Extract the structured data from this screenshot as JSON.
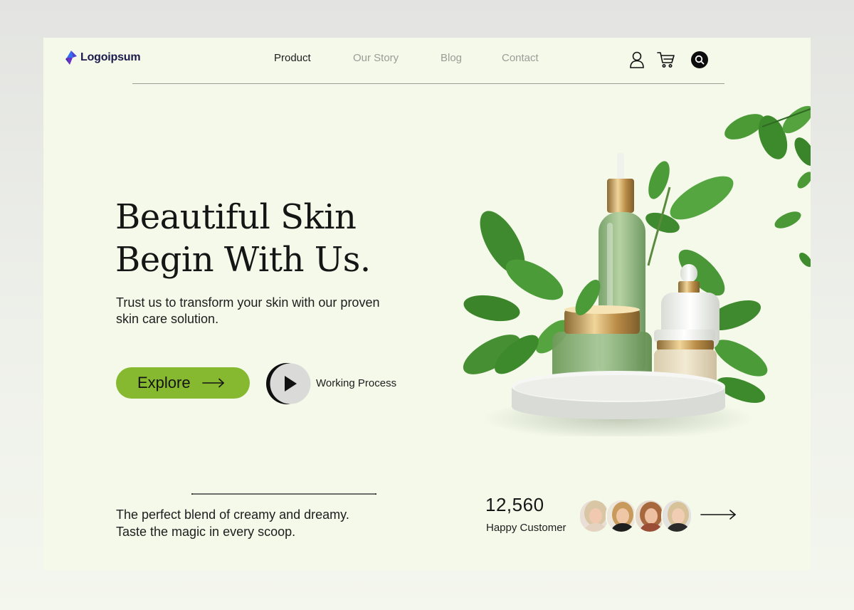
{
  "brand": {
    "name": "Logoipsum"
  },
  "nav": {
    "items": [
      {
        "label": "Product",
        "active": true
      },
      {
        "label": "Our Story",
        "active": false
      },
      {
        "label": "Blog",
        "active": false
      },
      {
        "label": "Contact",
        "active": false
      }
    ],
    "icons": [
      "user-icon",
      "cart-icon",
      "search-icon"
    ]
  },
  "hero": {
    "title_line1": "Beautiful Skin",
    "title_line2": "Begin With Us.",
    "subtitle": "Trust us to transform your skin with our proven skin care solution.",
    "cta_label": "Explore",
    "video_label": "Working Process"
  },
  "bottom": {
    "tagline_line1": "The perfect blend of creamy and dreamy.",
    "tagline_line2": "Taste the magic in every scoop.",
    "customer_count": "12,560",
    "customer_label": "Happy Customer"
  },
  "colors": {
    "accent": "#86b930",
    "background": "#f4f9ea",
    "text": "#151515",
    "muted": "#9a9d97",
    "logo": "#3f3cc4"
  }
}
